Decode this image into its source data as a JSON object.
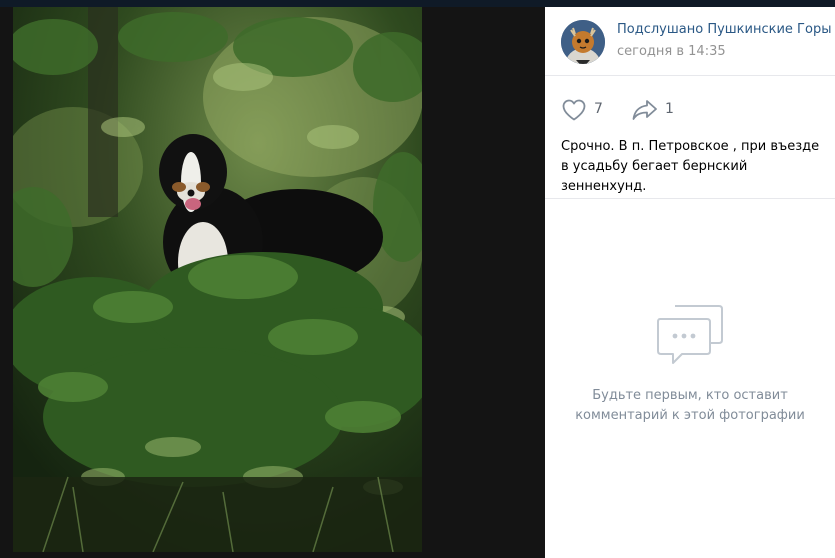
{
  "post": {
    "author": "Подслушано Пушкинские Горы",
    "date": "сегодня в 14:35",
    "likes": "7",
    "shares": "1",
    "caption": "Срочно. В п. Петровское , при въезде в усадьбу бегает бернский зенненхунд."
  },
  "comments": {
    "empty_line1": "Будьте первым, кто оставит",
    "empty_line2": "комментарий к этой фотографии"
  },
  "icons": {
    "like": "heart-icon",
    "share": "share-arrow-icon",
    "empty": "chat-bubbles-icon"
  },
  "colors": {
    "link": "#2a5885",
    "muted": "#939393",
    "icon": "#818c99",
    "background": "#141414"
  }
}
